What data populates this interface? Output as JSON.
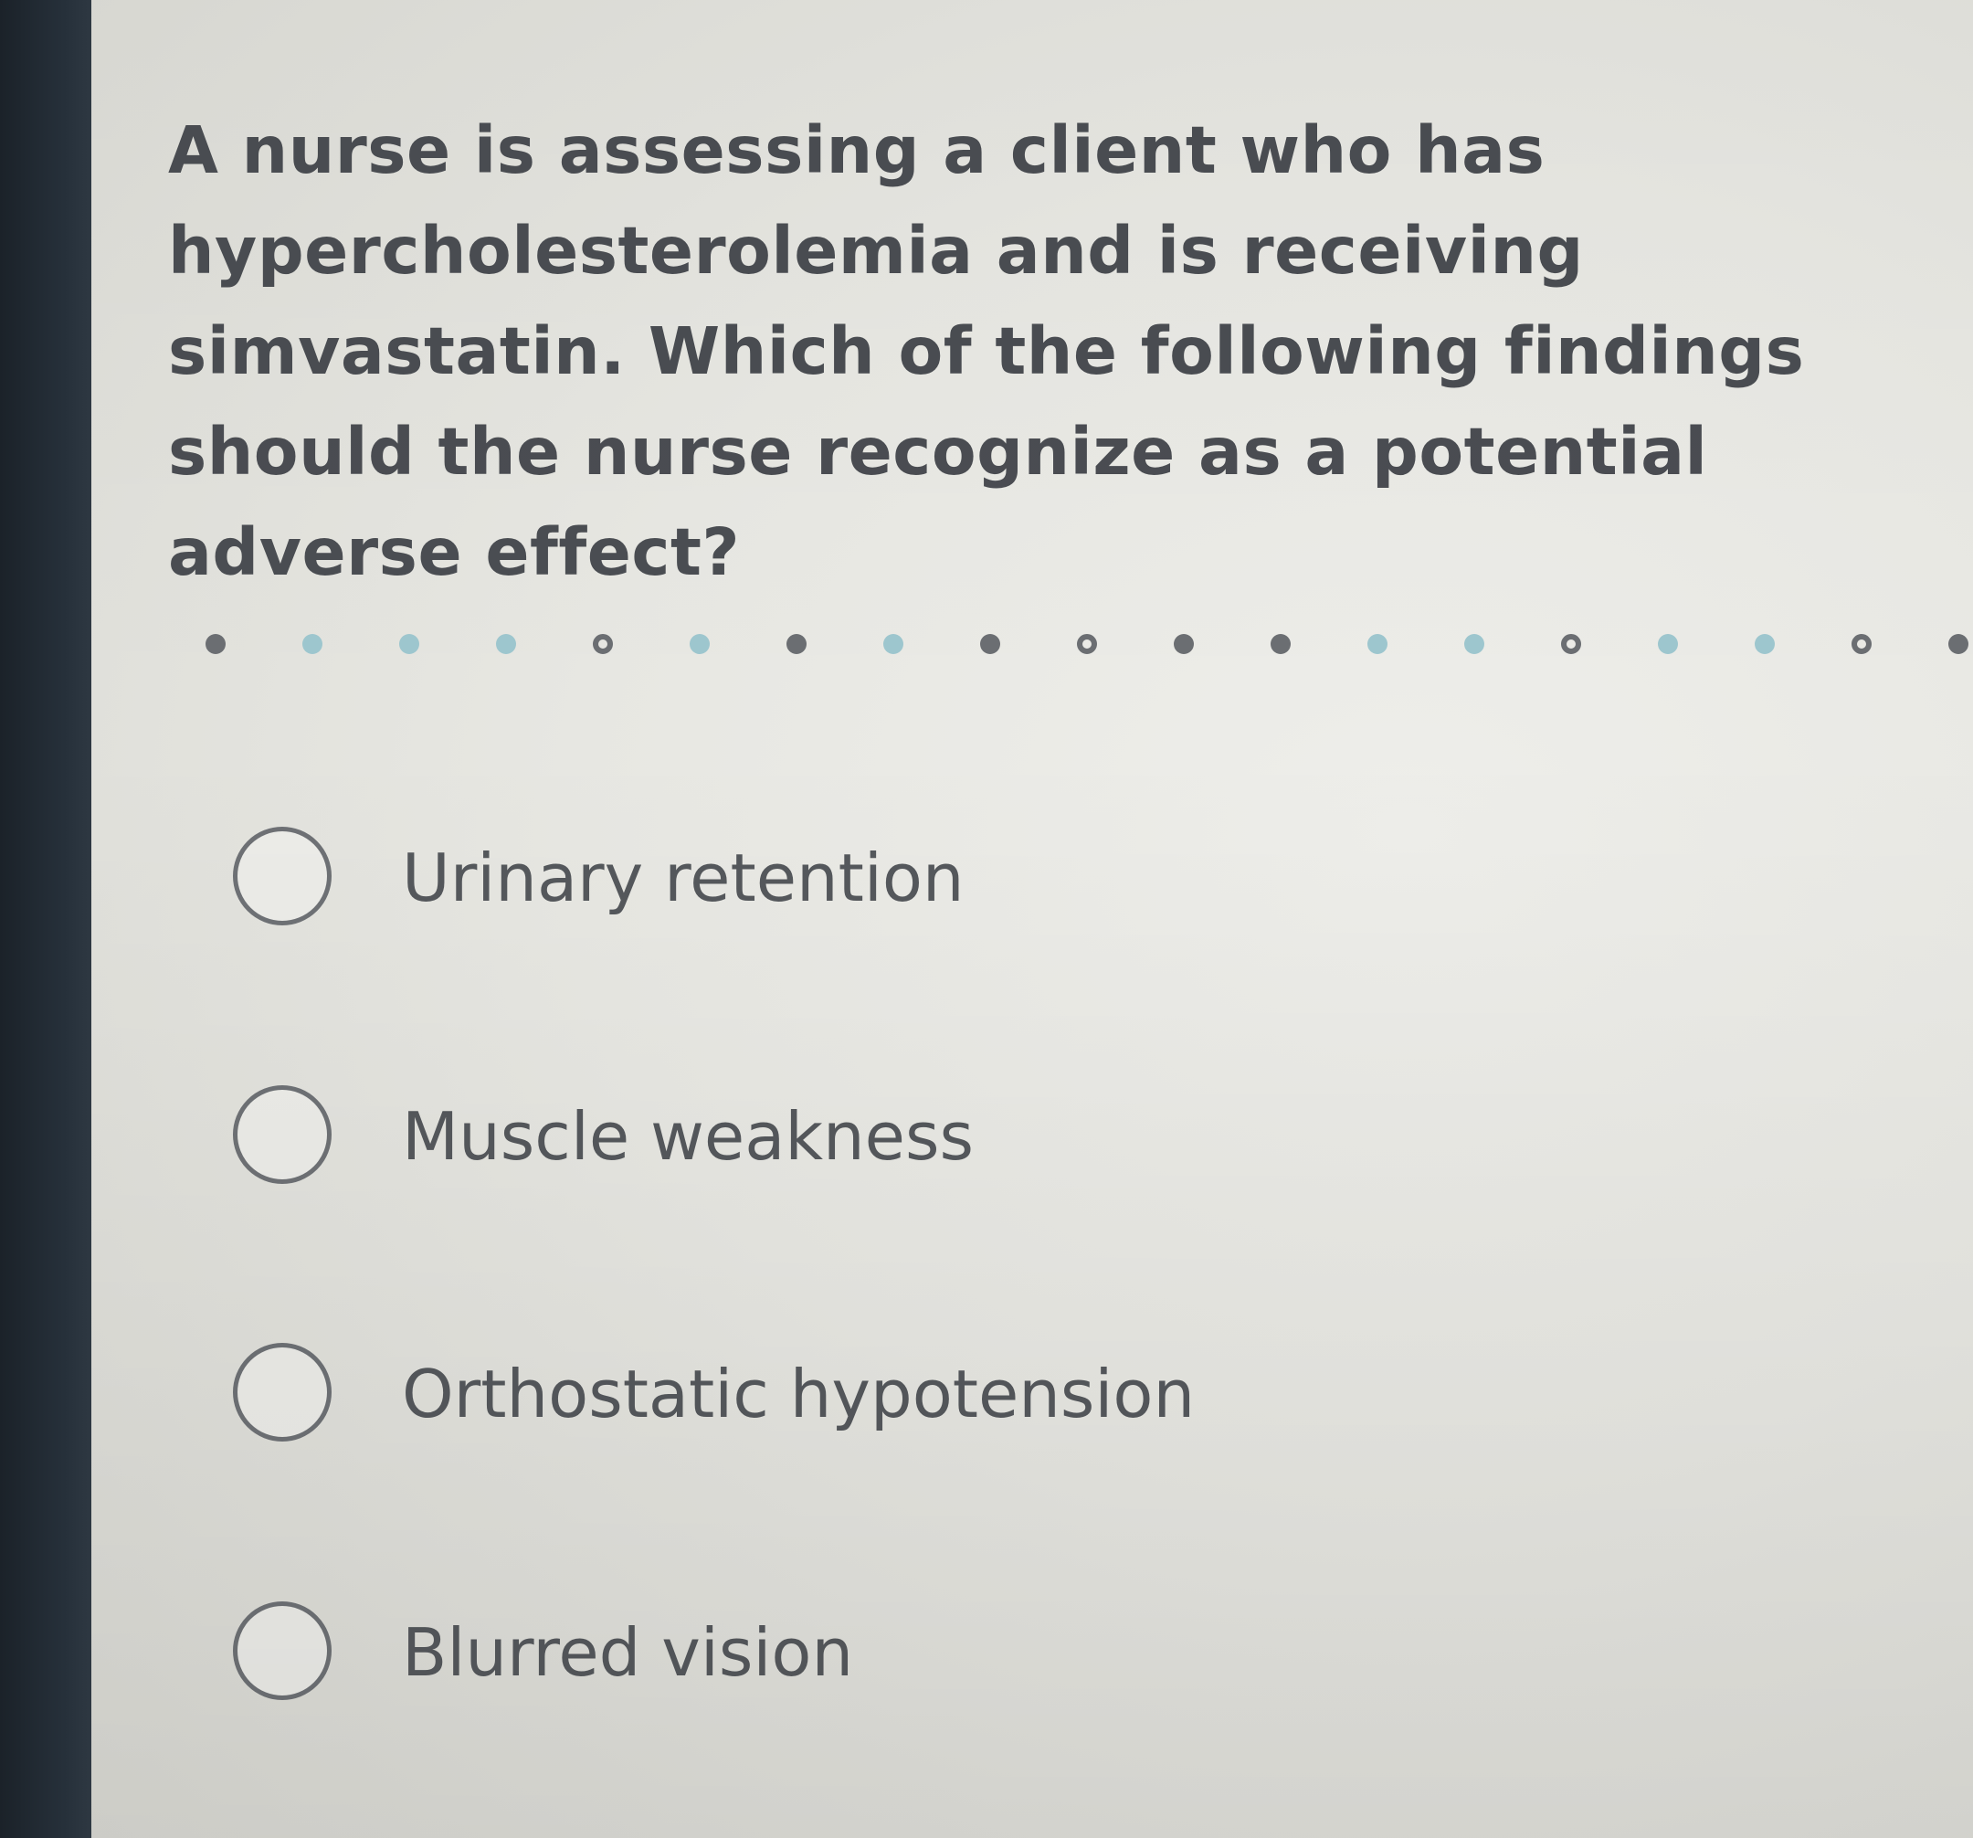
{
  "question": {
    "text": "A nurse is assessing a client who has hypercholesterolemia and is receiving simvastatin. Which of the following findings should the nurse recognize as a potential adverse effect?"
  },
  "progress": {
    "dots": [
      "answered",
      "teal",
      "teal",
      "teal",
      "open",
      "teal",
      "answered",
      "teal",
      "answered",
      "open",
      "answered",
      "answered",
      "teal",
      "teal",
      "open",
      "teal",
      "teal",
      "open",
      "answered"
    ]
  },
  "options": [
    {
      "label": "Urinary retention",
      "selected": false
    },
    {
      "label": "Muscle weakness",
      "selected": false
    },
    {
      "label": "Orthostatic hypotension",
      "selected": false
    },
    {
      "label": "Blurred vision",
      "selected": false
    }
  ],
  "colors": {
    "answered": "#6b6e72",
    "teal": "#9dc6ce",
    "text": "#4a4d52"
  }
}
